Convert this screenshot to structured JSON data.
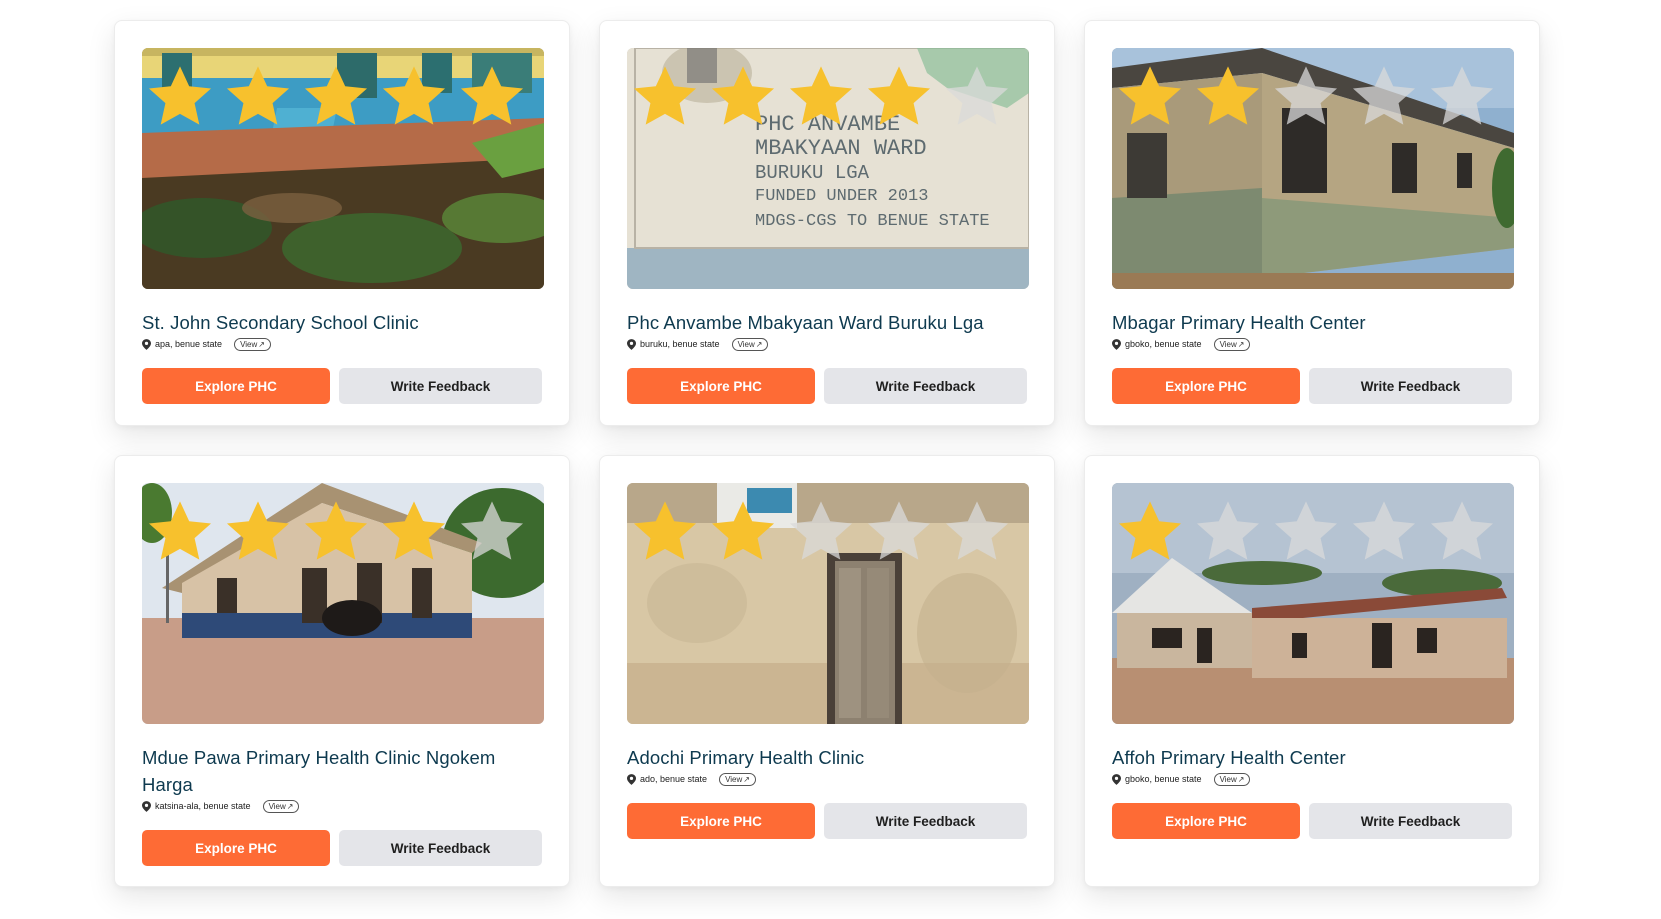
{
  "accent_color": "#fe6b35",
  "star_color": "#f7c12d",
  "star_empty_color": "#d9d9d9",
  "cards": [
    {
      "title": "St. John Secondary School Clinic",
      "location": "apa, benue state",
      "view_label": "View",
      "rating": 5,
      "explore_label": "Explore PHC",
      "feedback_label": "Write Feedback"
    },
    {
      "title": "Phc Anvambe Mbakyaan Ward Buruku Lga",
      "location": "buruku, benue state",
      "view_label": "View",
      "rating": 4,
      "explore_label": "Explore PHC",
      "feedback_label": "Write Feedback",
      "photo_text": [
        "PHC ANVAMBE",
        "MBAKYAAN WARD",
        "BURUKU LGA",
        "FUNDED UNDER 2013",
        "MDGS-CGS TO BENUE STATE"
      ]
    },
    {
      "title": "Mbagar Primary Health Center",
      "location": "gboko, benue state",
      "view_label": "View",
      "rating": 2,
      "explore_label": "Explore PHC",
      "feedback_label": "Write Feedback"
    },
    {
      "title": "Mdue Pawa Primary Health Clinic Ngokem Harga",
      "location": "katsina-ala, benue state",
      "view_label": "View",
      "rating": 4,
      "explore_label": "Explore PHC",
      "feedback_label": "Write Feedback"
    },
    {
      "title": "Adochi Primary Health Clinic",
      "location": "ado, benue state",
      "view_label": "View",
      "rating": 2,
      "explore_label": "Explore PHC",
      "feedback_label": "Write Feedback"
    },
    {
      "title": "Affoh Primary Health Center",
      "location": "gboko, benue state",
      "view_label": "View",
      "rating": 1,
      "explore_label": "Explore PHC",
      "feedback_label": "Write Feedback"
    }
  ]
}
